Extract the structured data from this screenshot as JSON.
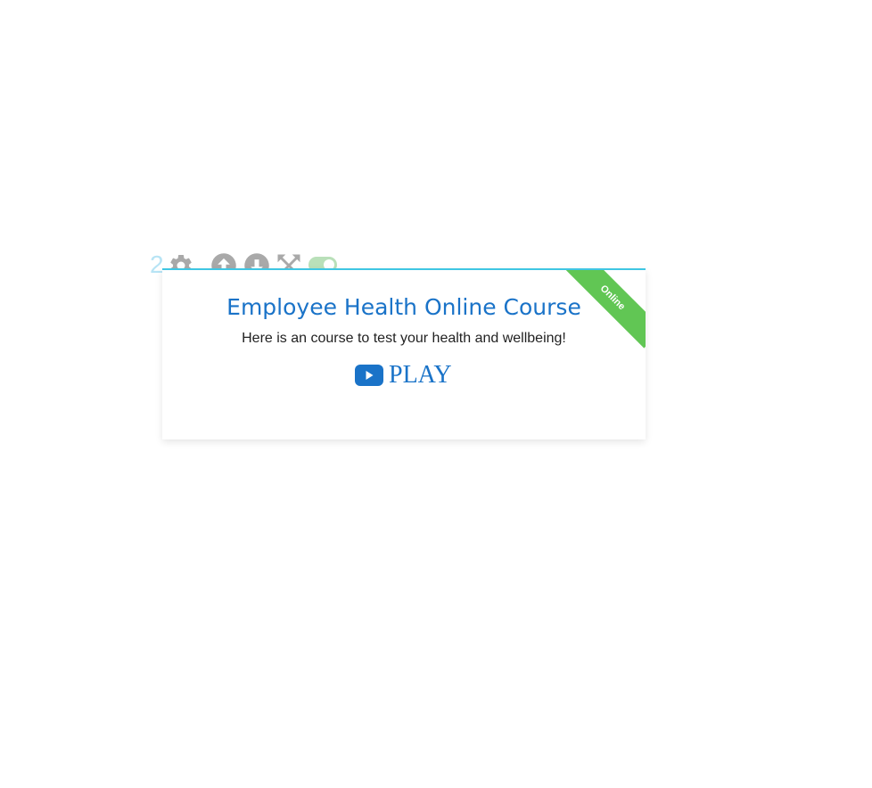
{
  "toolbar": {
    "order_number": "2",
    "icons": [
      "gear-icon",
      "arrow-up-circle-icon",
      "arrow-down-circle-icon",
      "expand-icon"
    ],
    "toggle_state": "on"
  },
  "card": {
    "ribbon_label": "Online",
    "title": "Employee Health Online Course",
    "description": "Here is an course to test your health and wellbeing!",
    "play_label": "PLAY"
  },
  "colors": {
    "accent": "#1a73c8",
    "ribbon": "#61c654",
    "top_border": "#3fc6e3",
    "icon_gray": "#a9a9a9"
  }
}
